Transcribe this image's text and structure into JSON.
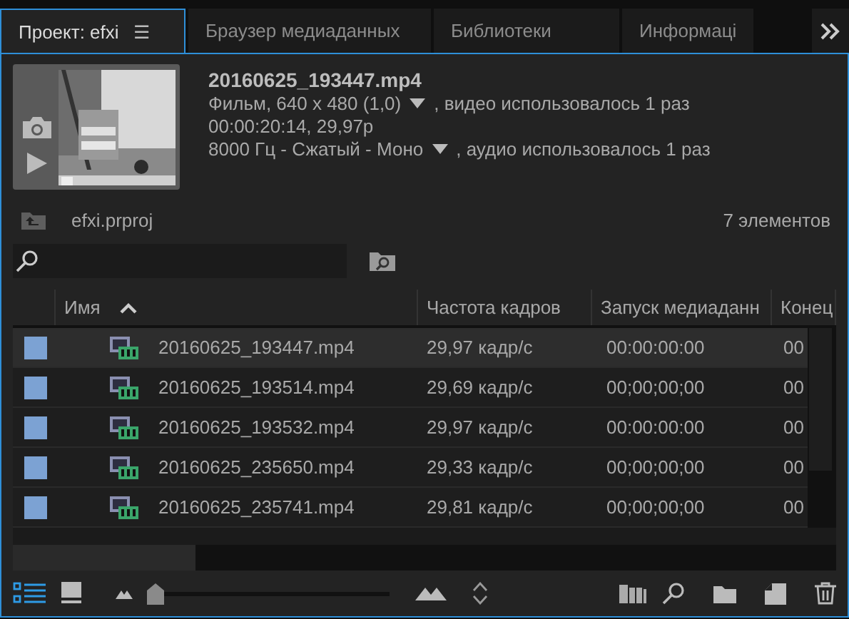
{
  "tabs": [
    {
      "label": "Проект: efxi",
      "selected": true,
      "menu": "☰"
    },
    {
      "label": "Браузер медиаданных",
      "selected": false
    },
    {
      "label": "Библиотеки",
      "selected": false
    },
    {
      "label": "Информаці",
      "selected": false
    }
  ],
  "preview": {
    "kind": "picture",
    "filename": "20160625_193447.mp4",
    "video_info": "Фильм, 640 x 480 (1,0)",
    "video_usage": ", видео использовалось 1 раз",
    "duration": "00:00:20:14, 29,97p",
    "audio_info": "8000 Гц - Сжатый - Моно",
    "audio_usage": ", аудио использовалось 1 раз"
  },
  "project": {
    "name": "efxi.prproj",
    "count": "7 элементов"
  },
  "table": {
    "columns": [
      "Имя",
      "Частота кадров",
      "Запуск медиаданн",
      "Конец"
    ],
    "rows": [
      {
        "name": "20160625_193447.mp4",
        "fps": "29,97 кадр/с",
        "start": "00:00:00:00",
        "end": "00",
        "selected": true
      },
      {
        "name": "20160625_193514.mp4",
        "fps": "29,69 кадр/с",
        "start": "00;00;00;00",
        "end": "00",
        "selected": false
      },
      {
        "name": "20160625_193532.mp4",
        "fps": "29,97 кадр/с",
        "start": "00:00:00:00",
        "end": "00",
        "selected": false
      },
      {
        "name": "20160625_235650.mp4",
        "fps": "29,33 кадр/с",
        "start": "00;00;00;00",
        "end": "00",
        "selected": false
      },
      {
        "name": "20160625_235741.mp4",
        "fps": "29,81 кадр/с",
        "start": "00;00;00;00",
        "end": "00",
        "selected": false
      }
    ]
  },
  "toolbar": {
    "list_view_selected": true,
    "zoom": {
      "level": 0
    }
  }
}
